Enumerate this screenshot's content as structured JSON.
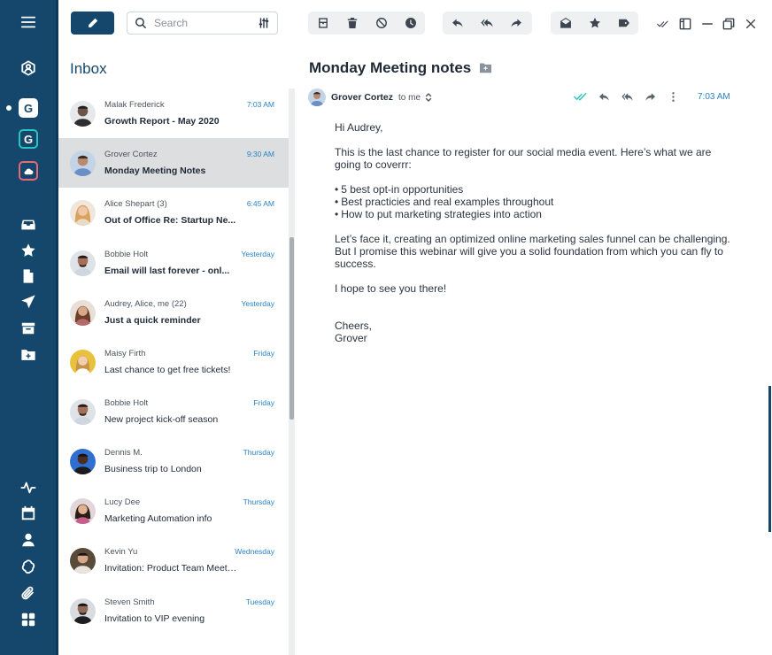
{
  "nav": {
    "accounts": [
      "G",
      "G",
      ""
    ]
  },
  "toolbar": {
    "search_placeholder": "Search"
  },
  "inbox": {
    "title": "Inbox",
    "items": [
      {
        "sender": "Malak Frederick",
        "time": "7:03 AM",
        "subject": "Growth Report - May 2020",
        "unread": true
      },
      {
        "sender": "Grover Cortez",
        "time": "9:30 AM",
        "subject": "Monday Meeting Notes",
        "unread": true,
        "selected": true
      },
      {
        "sender": "Alice Shepart (3)",
        "time": "6:45 AM",
        "subject": "Out of Office Re: Startup Ne...",
        "unread": true
      },
      {
        "sender": "Bobbie Holt",
        "time": "Yesterday",
        "subject": "Email will last forever - onl...",
        "unread": true
      },
      {
        "sender": "Audrey, Alice, me (22)",
        "time": "Yesterday",
        "subject": "Just a quick reminder",
        "unread": true
      },
      {
        "sender": "Maisy Firth",
        "time": "Friday",
        "subject": "Last chance to get free tickets!",
        "unread": false
      },
      {
        "sender": "Bobbie Holt",
        "time": "Friday",
        "subject": "New project kick-off season",
        "unread": false
      },
      {
        "sender": "Dennis M.",
        "time": "Thursday",
        "subject": "Business trip to London",
        "unread": false
      },
      {
        "sender": "Lucy Dee",
        "time": "Thursday",
        "subject": "Marketing Automation info",
        "unread": false
      },
      {
        "sender": "Kevin Yu",
        "time": "Wednesday",
        "subject": "Invitation: Product Team Meeting",
        "unread": false
      },
      {
        "sender": "Steven Smith",
        "time": "Tuesday",
        "subject": "Invitation to VIP evening",
        "unread": false
      }
    ]
  },
  "message": {
    "title": "Monday Meeting notes",
    "sender": "Grover Cortez",
    "to": "to me",
    "time": "7:03 AM",
    "greeting": "Hi Audrey,",
    "para1": "This is the last chance to register for our social media event. Here’s what we are going to coverrr:",
    "bullets": [
      "5 best opt-in opportunities",
      "Best practicies and real examples throughout",
      "How to put marketing strategies into action"
    ],
    "para2": "Let’s face it, creating an optimized online marketing sales funnel can be challenging. But I promise this webinar will give you a solid foundation from which you can fly to success.",
    "para3": "I hope to see you there!",
    "closing": "Cheers,",
    "signature": "Grover"
  },
  "colors": {
    "rail": "#15466b",
    "accent": "#2a82c6",
    "selected_row": "#dcdee0",
    "read_check": "#2bc4c0"
  }
}
